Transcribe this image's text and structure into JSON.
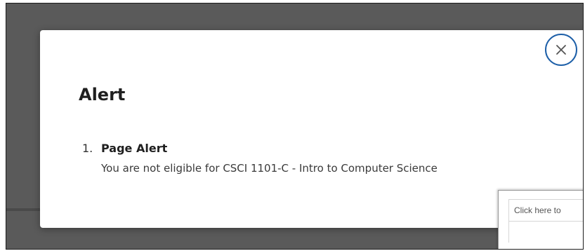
{
  "modal": {
    "title": "Alert",
    "close_icon": "close-icon",
    "accent_color": "#1d5fa8",
    "items": [
      {
        "number": "1.",
        "heading": "Page Alert",
        "message": "You are not eligible for CSCI 1101-C - Intro to Computer Science"
      }
    ]
  },
  "background_panel": {
    "field_text": "Click here to"
  }
}
